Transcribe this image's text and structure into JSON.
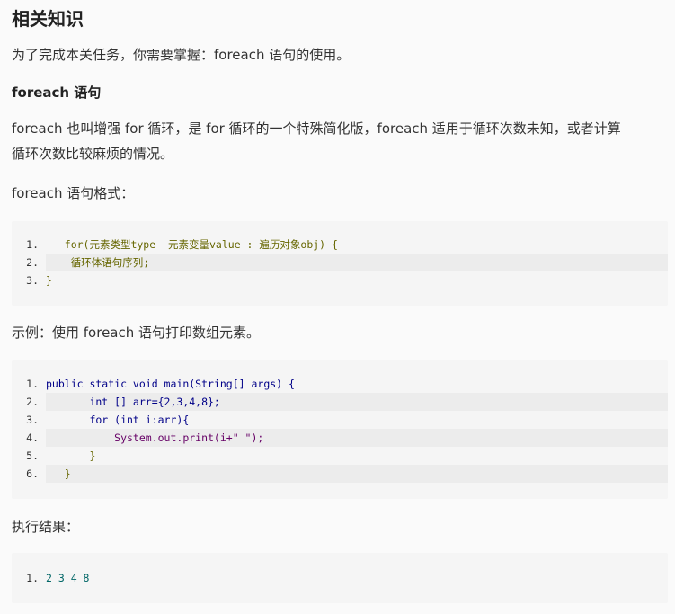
{
  "section_title": "相关知识",
  "intro": "为了完成本关任务，你需要掌握：foreach 语句的使用。",
  "foreach_heading": "foreach 语句",
  "foreach_desc_1": "foreach 也叫增强 for 循环，是 for 循环的一个特殊简化版，foreach 适用于循环次数未知，或者计算",
  "foreach_desc_2": "循环次数比较麻烦的情况。",
  "format_label": "foreach 语句格式：",
  "code1": {
    "lines": [
      {
        "num": "1.",
        "text": "   for(元素类型type  元素变量value : 遍历对象obj) {"
      },
      {
        "num": "2.",
        "text": "    循环体语句序列;"
      },
      {
        "num": "3.",
        "text": "}"
      }
    ]
  },
  "example_label": "示例：使用 foreach 语句打印数组元素。",
  "code2": {
    "lines": [
      {
        "num": "1.",
        "text": "public static void main(String[] args) {"
      },
      {
        "num": "2.",
        "text": "       int [] arr={2,3,4,8};"
      },
      {
        "num": "3.",
        "text": "       for (int i:arr){"
      },
      {
        "num": "4.",
        "text": "           System.out.print(i+\" \");"
      },
      {
        "num": "5.",
        "text": "       }"
      },
      {
        "num": "6.",
        "text": "   }"
      }
    ]
  },
  "result_label": "执行结果：",
  "code3": {
    "lines": [
      {
        "num": "1.",
        "text": "2 3 4 8"
      }
    ]
  }
}
